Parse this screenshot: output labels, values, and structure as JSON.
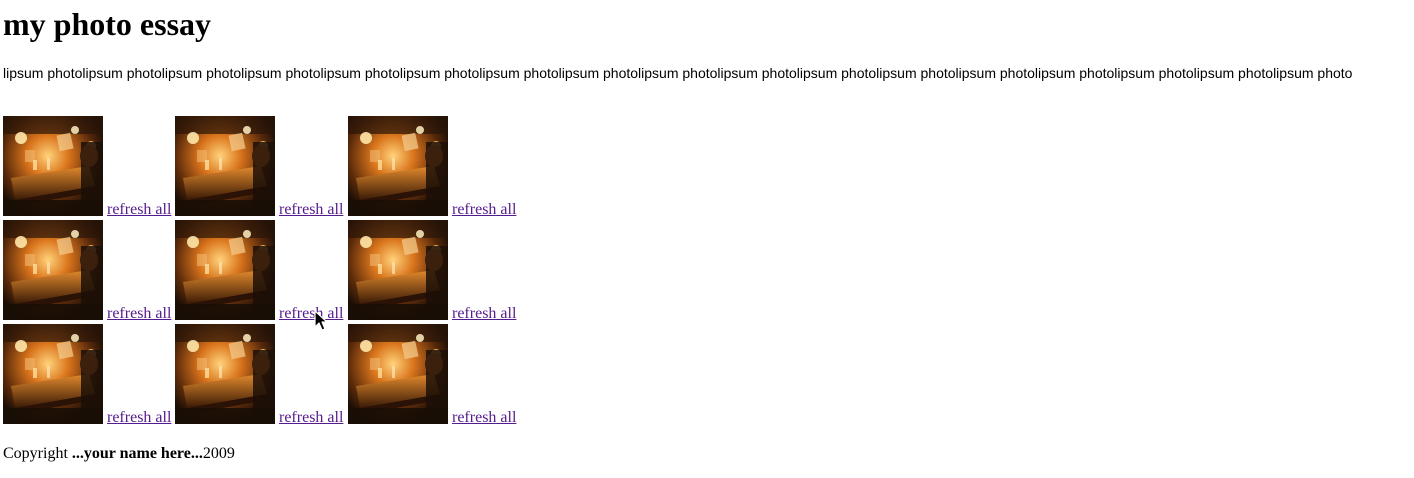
{
  "page": {
    "title": "my photo essay",
    "intro": "lipsum photolipsum photolipsum photolipsum photolipsum photolipsum photolipsum photolipsum photolipsum photolipsum photolipsum photolipsum photolipsum photolipsum photolipsum photolipsum photolipsum photo"
  },
  "gallery": {
    "rows": [
      {
        "cells": [
          {
            "link": "refresh all"
          },
          {
            "link": "refresh all"
          },
          {
            "link": "refresh all"
          }
        ]
      },
      {
        "cells": [
          {
            "link": "refresh all"
          },
          {
            "link": "refresh all"
          },
          {
            "link": "refresh all"
          }
        ]
      },
      {
        "cells": [
          {
            "link": "refresh all"
          },
          {
            "link": "refresh all"
          },
          {
            "link": "refresh all"
          }
        ]
      }
    ]
  },
  "footer": {
    "prefix": "Copyright ",
    "name": "...your name here...",
    "year": "2009"
  },
  "colors": {
    "link": "#551a8b",
    "photo_dark": "#1a0e06",
    "photo_warm": "#d9741c"
  }
}
